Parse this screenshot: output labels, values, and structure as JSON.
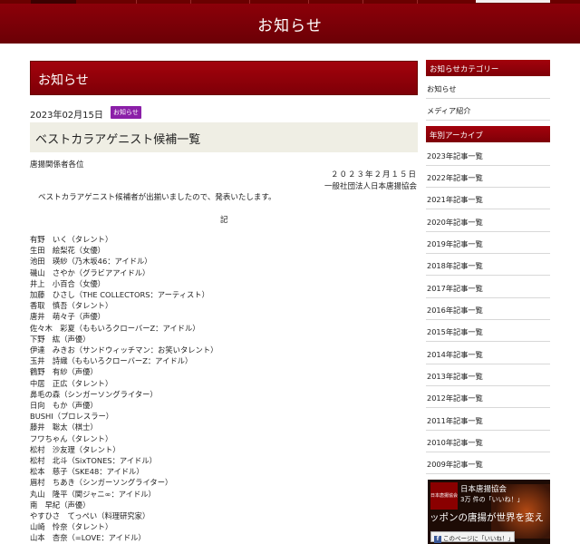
{
  "banner_title": "お知らせ",
  "main": {
    "section_title": "お知らせ",
    "date": "2023年02月15日",
    "category_badge": "お知らせ",
    "post_title": "ベストカラアゲニスト候補一覧",
    "addressee": "唐揚関係者各位",
    "letter_date": "２０２３年２月１５日",
    "sender": "一般社団法人日本唐揚協会",
    "intro": "ベストカラアゲニスト候補者が出揃いましたので、発表いたします。",
    "ki": "記",
    "candidates": [
      "有野　いく（タレント）",
      "生田　絵梨花（女優）",
      "池田　瑛紗（乃木坂46：アイドル）",
      "磯山　さやか（グラビアアイドル）",
      "井上　小百合（女優）",
      "加藤　ひさし（THE COLLECTORS：アーティスト）",
      "香取　慎吾（タレント）",
      "唐井　萌々子（声優）",
      "佐々木　彩夏（ももいろクローバーZ：アイドル）",
      "下野　紘（声優）",
      "伊達　みきお（サンドウィッチマン：お笑いタレント）",
      "玉井　詩織（ももいろクローバーZ：アイドル）",
      "鶴野　有紗（声優）",
      "中居　正広（タレント）",
      "鼻毛の森（シンガーソングライター）",
      "日向　もか（声優）",
      "BUSHI（プロレスラー）",
      "藤井　聡太（棋士）",
      "フワちゃん（タレント）",
      "松村　沙友理（タレント）",
      "松村　北斗（SixTONES：アイドル）",
      "松本　慈子（SKE48：アイドル）",
      "眉村　ちあき（シンガーソングライター）",
      "丸山　隆平（関ジャニ∞：アイドル）",
      "南　早紀（声優）",
      "やすひさ　てっぺい（料理研究家）",
      "山崎　怜奈（タレント）",
      "山本　杏奈（=LOVE：アイドル）"
    ]
  },
  "sidebar": {
    "category_heading": "お知らせカテゴリー",
    "categories": [
      "お知らせ",
      "メディア紹介"
    ],
    "archive_heading": "年別アーカイブ",
    "archives": [
      "2023年記事一覧",
      "2022年記事一覧",
      "2021年記事一覧",
      "2020年記事一覧",
      "2019年記事一覧",
      "2018年記事一覧",
      "2017年記事一覧",
      "2016年記事一覧",
      "2015年記事一覧",
      "2014年記事一覧",
      "2013年記事一覧",
      "2012年記事一覧",
      "2011年記事一覧",
      "2010年記事一覧",
      "2009年記事一覧"
    ]
  },
  "facebook": {
    "page_name": "日本唐揚協会",
    "likes": "3万 件の「いいね！」",
    "slogan": "ッポンの唐揚が世界を変え",
    "like_button": "このページに「いいね！」",
    "logo_text": "日本唐揚協会"
  }
}
